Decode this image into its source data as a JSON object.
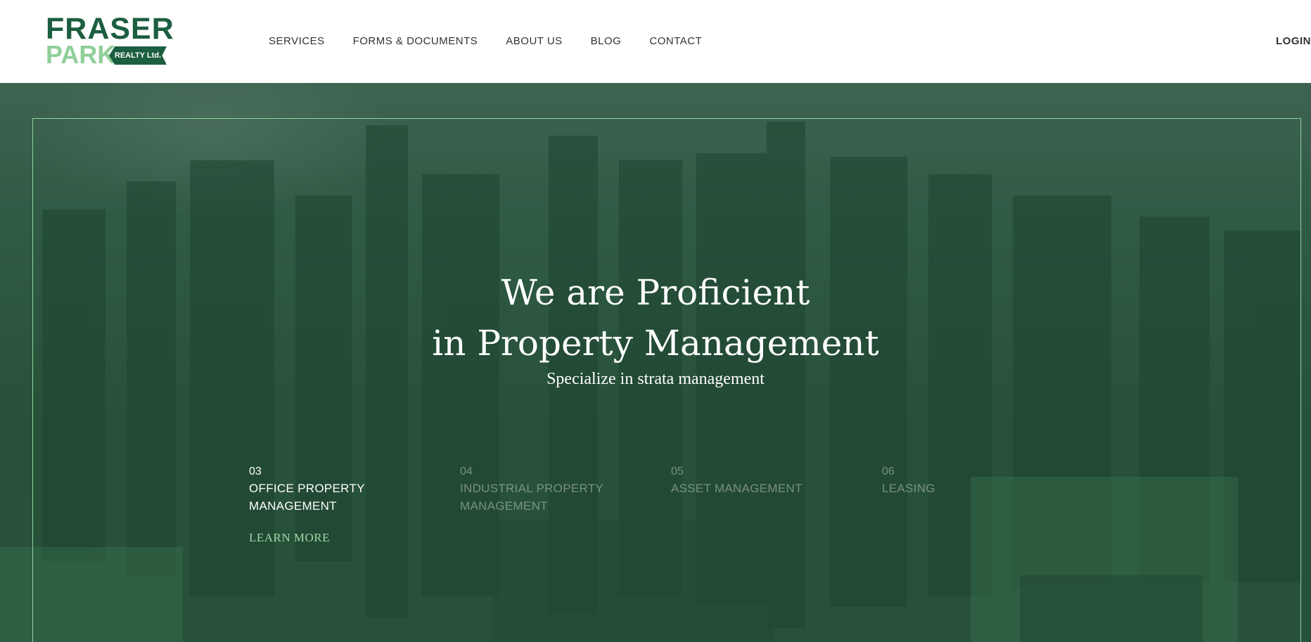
{
  "header": {
    "logo": {
      "line1": "FRASER",
      "line2": "PARK",
      "tag": "REALTY Ltd."
    },
    "nav": [
      {
        "label": "SERVICES"
      },
      {
        "label": "FORMS & DOCUMENTS"
      },
      {
        "label": "ABOUT US"
      },
      {
        "label": "BLOG"
      },
      {
        "label": "CONTACT"
      }
    ],
    "login_label": "LOGIN"
  },
  "hero": {
    "title_line1": "We are Proficient",
    "title_line2": "in Property Management",
    "subtitle": "Specialize in strata management",
    "tabs": [
      {
        "num": "03",
        "label": "OFFICE PROPERTY MANAGEMENT",
        "active": true
      },
      {
        "num": "04",
        "label": "INDUSTRIAL PROPERTY MANAGEMENT",
        "active": false
      },
      {
        "num": "05",
        "label": "ASSET MANAGEMENT",
        "active": false
      },
      {
        "num": "06",
        "label": "LEASING",
        "active": false
      }
    ],
    "learn_more": "LEARN MORE"
  },
  "colors": {
    "brand_dark": "#1c5e40",
    "brand_light": "#8fcf99",
    "hero_overlay": "#27513a",
    "accent": "#9fd8a8"
  }
}
